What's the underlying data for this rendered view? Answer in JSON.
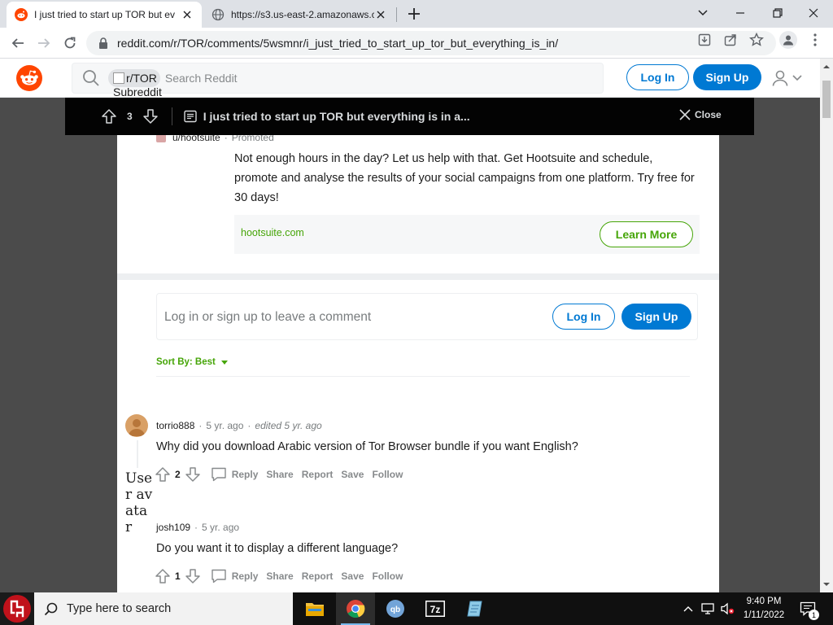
{
  "browser": {
    "tabs": [
      {
        "title": "I just tried to start up TOR but ev",
        "active": true
      },
      {
        "title": "https://s3.us-east-2.amazonaws.c",
        "active": false
      }
    ],
    "url": "reddit.com/r/TOR/comments/5wsmnr/i_just_tried_to_start_up_tor_but_everything_is_in/"
  },
  "header": {
    "subreddit_chip": "r/TOR",
    "subreddit_chip_sub": "Subreddit",
    "search_placeholder": "Search Reddit",
    "login_label": "Log In",
    "signup_label": "Sign Up"
  },
  "post_bar": {
    "vote_count": "3",
    "title": "I just tried to start up TOR but everything is in a...",
    "close_label": "Close"
  },
  "ad": {
    "user": "u/hootsuite",
    "promoted": "Promoted",
    "text": "Not enough hours in the day? Let us help with that. Get Hootsuite and schedule, promote and analyse the results of your social campaigns from one platform. Try free for 30 days!",
    "domain": "hootsuite.com",
    "cta": "Learn More"
  },
  "comment_box": {
    "prompt": "Log in or sign up to leave a comment",
    "login_label": "Log In",
    "signup_label": "Sign Up"
  },
  "sort": {
    "label": "Sort By: Best"
  },
  "comments": [
    {
      "author": "torrio888",
      "age": "5 yr. ago",
      "edited": "edited 5 yr. ago",
      "body": "Why did you download Arabic version of Tor Browser bundle if you want English?",
      "score": "2"
    },
    {
      "author": "josh109",
      "age": "5 yr. ago",
      "body": "Do you want it to display a different language?",
      "score": "1"
    }
  ],
  "actions": {
    "reply": "Reply",
    "share": "Share",
    "report": "Report",
    "save": "Save",
    "follow": "Follow"
  },
  "broken_avatar_alt": "User avatar",
  "taskbar": {
    "search_placeholder": "Type here to search",
    "apps": [
      "file-explorer",
      "chrome",
      "qbittorrent",
      "7-zip",
      "notepad"
    ],
    "time": "9:40 PM",
    "date": "1/11/2022",
    "notification_count": "1"
  },
  "colors": {
    "reddit_orange": "#ff4500",
    "reddit_blue": "#0079d3",
    "ad_green": "#46a508",
    "post_bar_bg": "#030303"
  }
}
